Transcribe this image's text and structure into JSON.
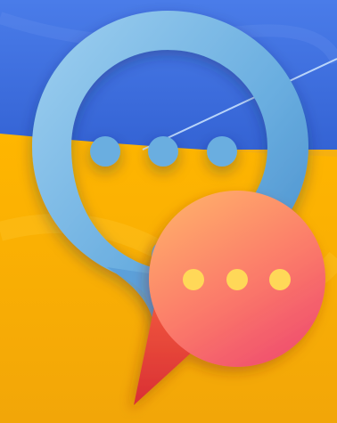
{
  "artwork": {
    "subject": "messenger-app-icon-on-ukrainian-flag",
    "colors": {
      "flag_blue": "#3f6fe0",
      "flag_yellow": "#ffb400",
      "bubble_ring_light": "#8dc4ea",
      "bubble_ring_dark": "#4f97d2",
      "bubble_dot": "#6aaee0",
      "bubble_coral_light": "#ffa06a",
      "bubble_coral_dark": "#f2506c",
      "bubble_tail_red": "#e63a3c",
      "bubble_dot_yellow": "#ffd858"
    },
    "back_bubble": {
      "shape": "ring-speech-bubble",
      "dot_count": 3
    },
    "front_bubble": {
      "shape": "filled-speech-bubble",
      "dot_count": 3
    }
  }
}
